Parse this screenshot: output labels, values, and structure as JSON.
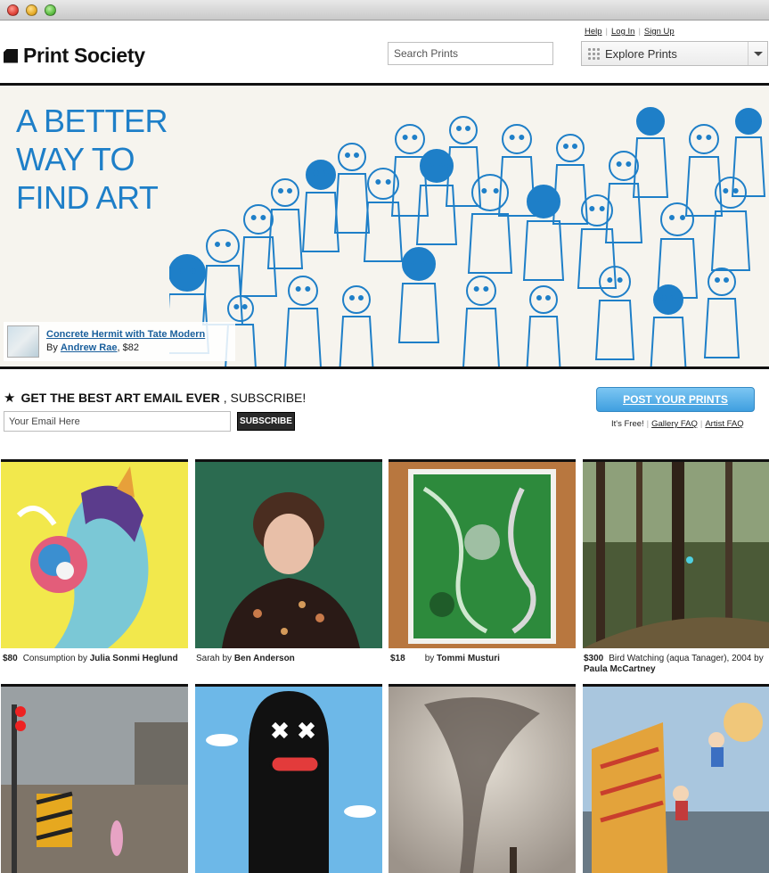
{
  "header": {
    "logo": "Print Society",
    "search_placeholder": "Search Prints",
    "links": [
      "Help",
      "Log In",
      "Sign Up"
    ],
    "explore_label": "Explore Prints"
  },
  "hero": {
    "title_lines": [
      "A BETTER",
      "WAY TO",
      "FIND ART"
    ],
    "caption_title": "Concrete Hermit with Tate Modern",
    "caption_by": "By",
    "caption_artist": "Andrew Rae",
    "caption_price": ", $82",
    "accent_color": "#1e7fc8"
  },
  "subscribe": {
    "headline_bold": "GET THE BEST ART EMAIL EVER",
    "headline_rest": ", SUBSCRIBE!",
    "email_placeholder": "Your Email Here",
    "button": "SUBSCRIBE"
  },
  "post": {
    "button": "POST YOUR PRINTS",
    "free": "It's Free!",
    "gallery_faq": "Gallery FAQ",
    "artist_faq": "Artist FAQ"
  },
  "gallery": [
    {
      "price": "$80",
      "title": "Consumption",
      "by": "by",
      "artist": "Julia Sonmi Heglund"
    },
    {
      "price": "",
      "title": "Sarah",
      "by": "by",
      "artist": "Ben Anderson"
    },
    {
      "price": "$18",
      "title": "",
      "by": "by",
      "artist": "Tommi Musturi"
    },
    {
      "price": "$300",
      "title": "Bird Watching (aqua Tanager), 2004",
      "by": "by",
      "artist": "Paula McCartney"
    }
  ]
}
